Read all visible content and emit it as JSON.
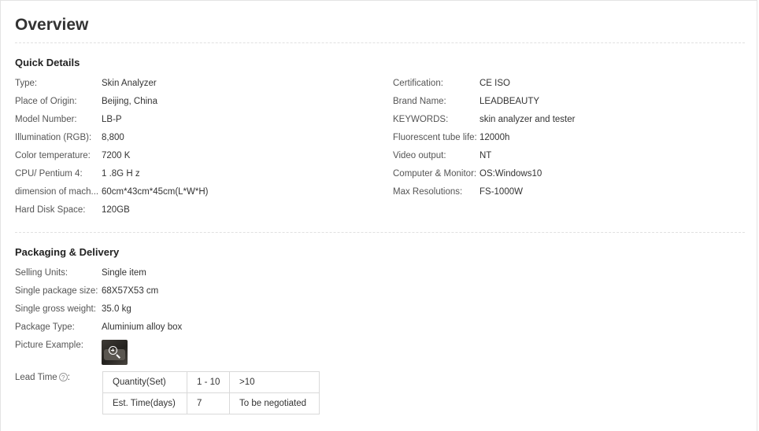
{
  "page": {
    "title": "Overview"
  },
  "quick_details": {
    "heading": "Quick Details",
    "left": [
      {
        "label": "Type:",
        "value": "Skin Analyzer"
      },
      {
        "label": "Place of Origin:",
        "value": "Beijing, China"
      },
      {
        "label": "Model Number:",
        "value": "LB-P"
      },
      {
        "label": "Illumination (RGB):",
        "value": "8,800"
      },
      {
        "label": "Color temperature:",
        "value": "7200 K"
      },
      {
        "label": "CPU/ Pentium 4:",
        "value": "1 .8G H z"
      },
      {
        "label": "dimension of mach...",
        "value": "60cm*43cm*45cm(L*W*H)"
      },
      {
        "label": "Hard Disk Space:",
        "value": "120GB"
      }
    ],
    "right": [
      {
        "label": "Certification:",
        "value": "CE ISO"
      },
      {
        "label": "Brand Name:",
        "value": "LEADBEAUTY"
      },
      {
        "label": "KEYWORDS:",
        "value": "skin analyzer and tester"
      },
      {
        "label": "Fluorescent tube life:",
        "value": "12000h"
      },
      {
        "label": "Video output:",
        "value": "NT"
      },
      {
        "label": "Computer & Monitor:",
        "value": "OS:Windows10"
      },
      {
        "label": "Max Resolutions:",
        "value": "FS-1000W"
      }
    ]
  },
  "packaging": {
    "heading": "Packaging & Delivery",
    "rows": [
      {
        "label": "Selling Units:",
        "value": "Single item"
      },
      {
        "label": "Single package size:",
        "value": "68X57X53 cm"
      },
      {
        "label": "Single gross weight:",
        "value": "35.0 kg"
      },
      {
        "label": "Package Type:",
        "value": "Aluminium alloy box"
      }
    ],
    "picture_label": "Picture Example:",
    "picture_icon": "zoom-in-icon",
    "lead_time_label": "Lead Time",
    "lead_time_help": "?",
    "lead_time_colon": ":",
    "lead_table": {
      "rows": [
        [
          "Quantity(Set)",
          "1 - 10",
          ">10"
        ],
        [
          "Est. Time(days)",
          "7",
          "To be negotiated"
        ]
      ]
    }
  }
}
